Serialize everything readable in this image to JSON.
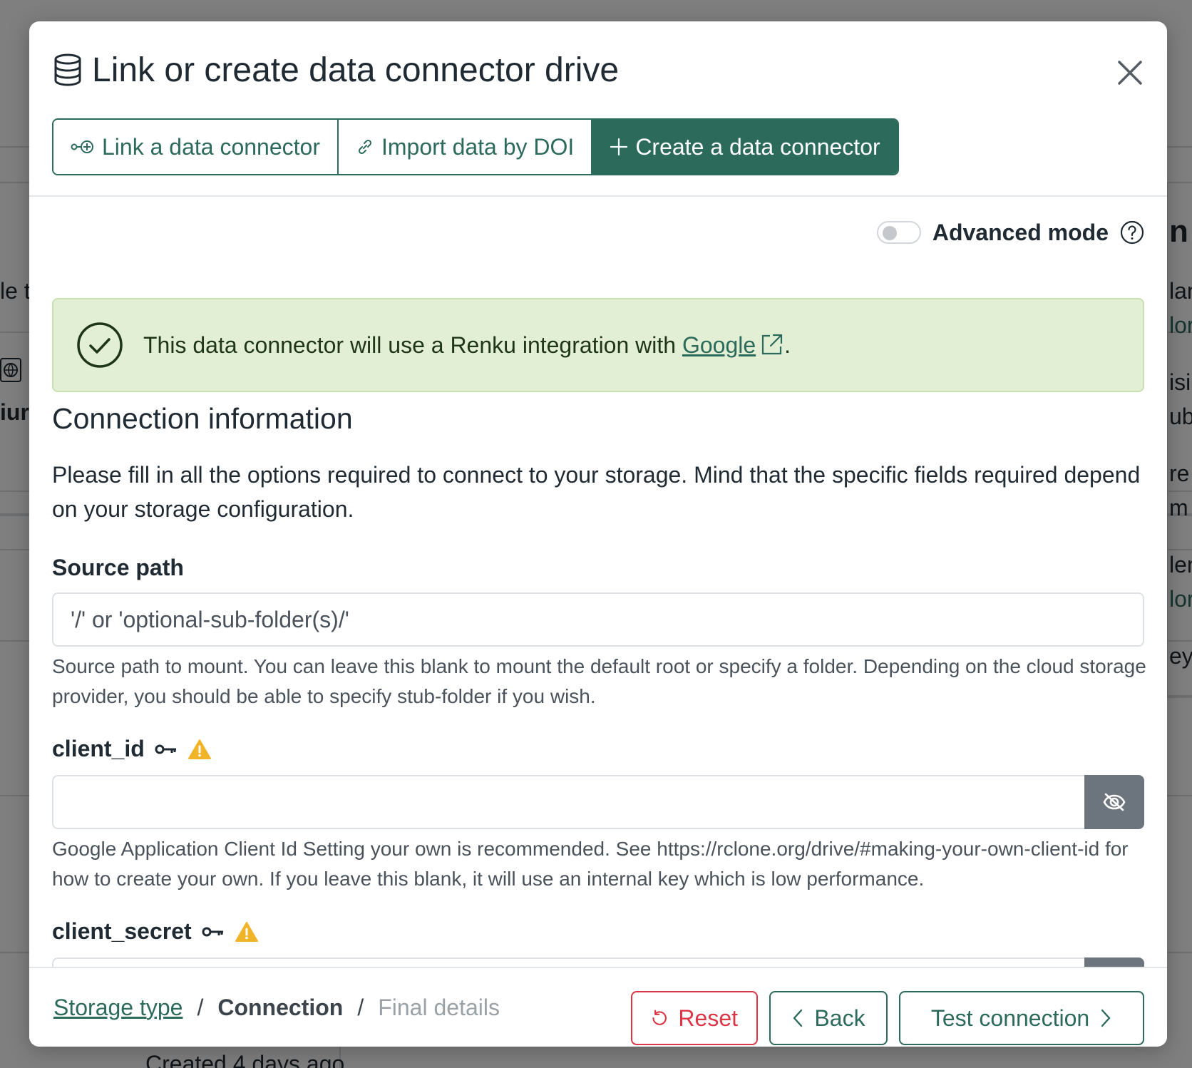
{
  "modal": {
    "title": "Link or create data connector drive",
    "tabs": [
      {
        "label": "Link a data connector",
        "icon": "link-plus-icon",
        "active": false
      },
      {
        "label": "Import data by DOI",
        "icon": "link-icon",
        "active": false
      },
      {
        "label": "Create a data connector",
        "icon": "plus-icon",
        "active": true
      }
    ]
  },
  "advanced_mode": {
    "label": "Advanced mode",
    "enabled": false
  },
  "alert": {
    "text": "This data connector will use a Renku integration with",
    "link_text": "Google",
    "suffix": ".",
    "color": "#e2efd4"
  },
  "connection": {
    "title": "Connection information",
    "description": "Please fill in all the options required to connect to your storage. Mind that the specific fields required depend on your storage configuration."
  },
  "fields": {
    "source_path": {
      "label": "Source path",
      "placeholder": "'/' or 'optional-sub-folder(s)/'",
      "help": "Source path to mount. You can leave this blank to mount the default root or specify a folder. Depending on the cloud storage provider, you should be able to specify stub-folder if you wish."
    },
    "client_id": {
      "label": "client_id",
      "value": "",
      "help": "Google Application Client Id Setting your own is recommended. See https://rclone.org/drive/#making-your-own-client-id for how to create your own. If you leave this blank, it will use an internal key which is low performance."
    },
    "client_secret": {
      "label": "client_secret",
      "value": ""
    }
  },
  "footer": {
    "breadcrumb": {
      "step1": "Storage type",
      "step2": "Connection",
      "step3": "Final details",
      "separator": "/"
    },
    "buttons": {
      "reset": "Reset",
      "back": "Back",
      "test": "Test connection"
    }
  },
  "background": {
    "fragments": [
      "le t",
      "iur",
      "Created 4 days ago",
      "n",
      "lan",
      "lor",
      "isi",
      "ub",
      "re",
      "m",
      "len",
      "lor",
      "ey"
    ]
  },
  "colors": {
    "brand": "#2c6b5c",
    "danger": "#dc3545",
    "warning": "#f0b429",
    "overlay": "rgba(0,0,0,0.5)"
  }
}
